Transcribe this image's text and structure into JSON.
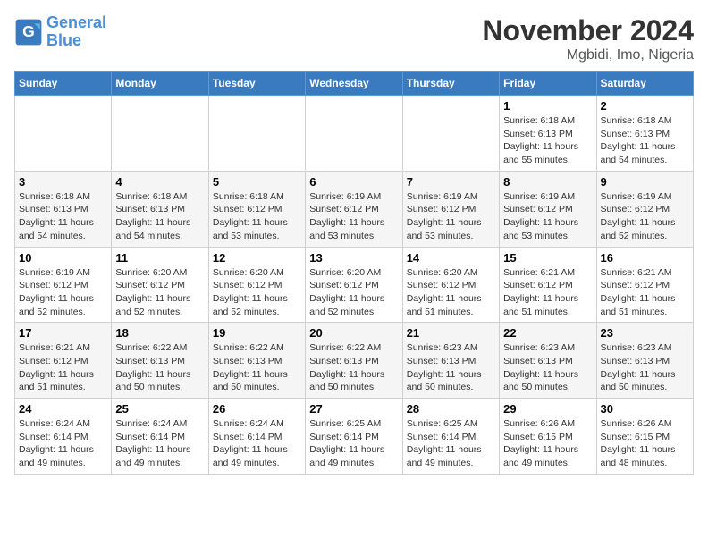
{
  "logo": {
    "line1": "General",
    "line2": "Blue"
  },
  "title": "November 2024",
  "location": "Mgbidi, Imo, Nigeria",
  "days_of_week": [
    "Sunday",
    "Monday",
    "Tuesday",
    "Wednesday",
    "Thursday",
    "Friday",
    "Saturday"
  ],
  "weeks": [
    [
      {
        "day": "",
        "info": ""
      },
      {
        "day": "",
        "info": ""
      },
      {
        "day": "",
        "info": ""
      },
      {
        "day": "",
        "info": ""
      },
      {
        "day": "",
        "info": ""
      },
      {
        "day": "1",
        "info": "Sunrise: 6:18 AM\nSunset: 6:13 PM\nDaylight: 11 hours\nand 55 minutes."
      },
      {
        "day": "2",
        "info": "Sunrise: 6:18 AM\nSunset: 6:13 PM\nDaylight: 11 hours\nand 54 minutes."
      }
    ],
    [
      {
        "day": "3",
        "info": "Sunrise: 6:18 AM\nSunset: 6:13 PM\nDaylight: 11 hours\nand 54 minutes."
      },
      {
        "day": "4",
        "info": "Sunrise: 6:18 AM\nSunset: 6:13 PM\nDaylight: 11 hours\nand 54 minutes."
      },
      {
        "day": "5",
        "info": "Sunrise: 6:18 AM\nSunset: 6:12 PM\nDaylight: 11 hours\nand 53 minutes."
      },
      {
        "day": "6",
        "info": "Sunrise: 6:19 AM\nSunset: 6:12 PM\nDaylight: 11 hours\nand 53 minutes."
      },
      {
        "day": "7",
        "info": "Sunrise: 6:19 AM\nSunset: 6:12 PM\nDaylight: 11 hours\nand 53 minutes."
      },
      {
        "day": "8",
        "info": "Sunrise: 6:19 AM\nSunset: 6:12 PM\nDaylight: 11 hours\nand 53 minutes."
      },
      {
        "day": "9",
        "info": "Sunrise: 6:19 AM\nSunset: 6:12 PM\nDaylight: 11 hours\nand 52 minutes."
      }
    ],
    [
      {
        "day": "10",
        "info": "Sunrise: 6:19 AM\nSunset: 6:12 PM\nDaylight: 11 hours\nand 52 minutes."
      },
      {
        "day": "11",
        "info": "Sunrise: 6:20 AM\nSunset: 6:12 PM\nDaylight: 11 hours\nand 52 minutes."
      },
      {
        "day": "12",
        "info": "Sunrise: 6:20 AM\nSunset: 6:12 PM\nDaylight: 11 hours\nand 52 minutes."
      },
      {
        "day": "13",
        "info": "Sunrise: 6:20 AM\nSunset: 6:12 PM\nDaylight: 11 hours\nand 52 minutes."
      },
      {
        "day": "14",
        "info": "Sunrise: 6:20 AM\nSunset: 6:12 PM\nDaylight: 11 hours\nand 51 minutes."
      },
      {
        "day": "15",
        "info": "Sunrise: 6:21 AM\nSunset: 6:12 PM\nDaylight: 11 hours\nand 51 minutes."
      },
      {
        "day": "16",
        "info": "Sunrise: 6:21 AM\nSunset: 6:12 PM\nDaylight: 11 hours\nand 51 minutes."
      }
    ],
    [
      {
        "day": "17",
        "info": "Sunrise: 6:21 AM\nSunset: 6:12 PM\nDaylight: 11 hours\nand 51 minutes."
      },
      {
        "day": "18",
        "info": "Sunrise: 6:22 AM\nSunset: 6:13 PM\nDaylight: 11 hours\nand 50 minutes."
      },
      {
        "day": "19",
        "info": "Sunrise: 6:22 AM\nSunset: 6:13 PM\nDaylight: 11 hours\nand 50 minutes."
      },
      {
        "day": "20",
        "info": "Sunrise: 6:22 AM\nSunset: 6:13 PM\nDaylight: 11 hours\nand 50 minutes."
      },
      {
        "day": "21",
        "info": "Sunrise: 6:23 AM\nSunset: 6:13 PM\nDaylight: 11 hours\nand 50 minutes."
      },
      {
        "day": "22",
        "info": "Sunrise: 6:23 AM\nSunset: 6:13 PM\nDaylight: 11 hours\nand 50 minutes."
      },
      {
        "day": "23",
        "info": "Sunrise: 6:23 AM\nSunset: 6:13 PM\nDaylight: 11 hours\nand 50 minutes."
      }
    ],
    [
      {
        "day": "24",
        "info": "Sunrise: 6:24 AM\nSunset: 6:14 PM\nDaylight: 11 hours\nand 49 minutes."
      },
      {
        "day": "25",
        "info": "Sunrise: 6:24 AM\nSunset: 6:14 PM\nDaylight: 11 hours\nand 49 minutes."
      },
      {
        "day": "26",
        "info": "Sunrise: 6:24 AM\nSunset: 6:14 PM\nDaylight: 11 hours\nand 49 minutes."
      },
      {
        "day": "27",
        "info": "Sunrise: 6:25 AM\nSunset: 6:14 PM\nDaylight: 11 hours\nand 49 minutes."
      },
      {
        "day": "28",
        "info": "Sunrise: 6:25 AM\nSunset: 6:14 PM\nDaylight: 11 hours\nand 49 minutes."
      },
      {
        "day": "29",
        "info": "Sunrise: 6:26 AM\nSunset: 6:15 PM\nDaylight: 11 hours\nand 49 minutes."
      },
      {
        "day": "30",
        "info": "Sunrise: 6:26 AM\nSunset: 6:15 PM\nDaylight: 11 hours\nand 48 minutes."
      }
    ]
  ]
}
